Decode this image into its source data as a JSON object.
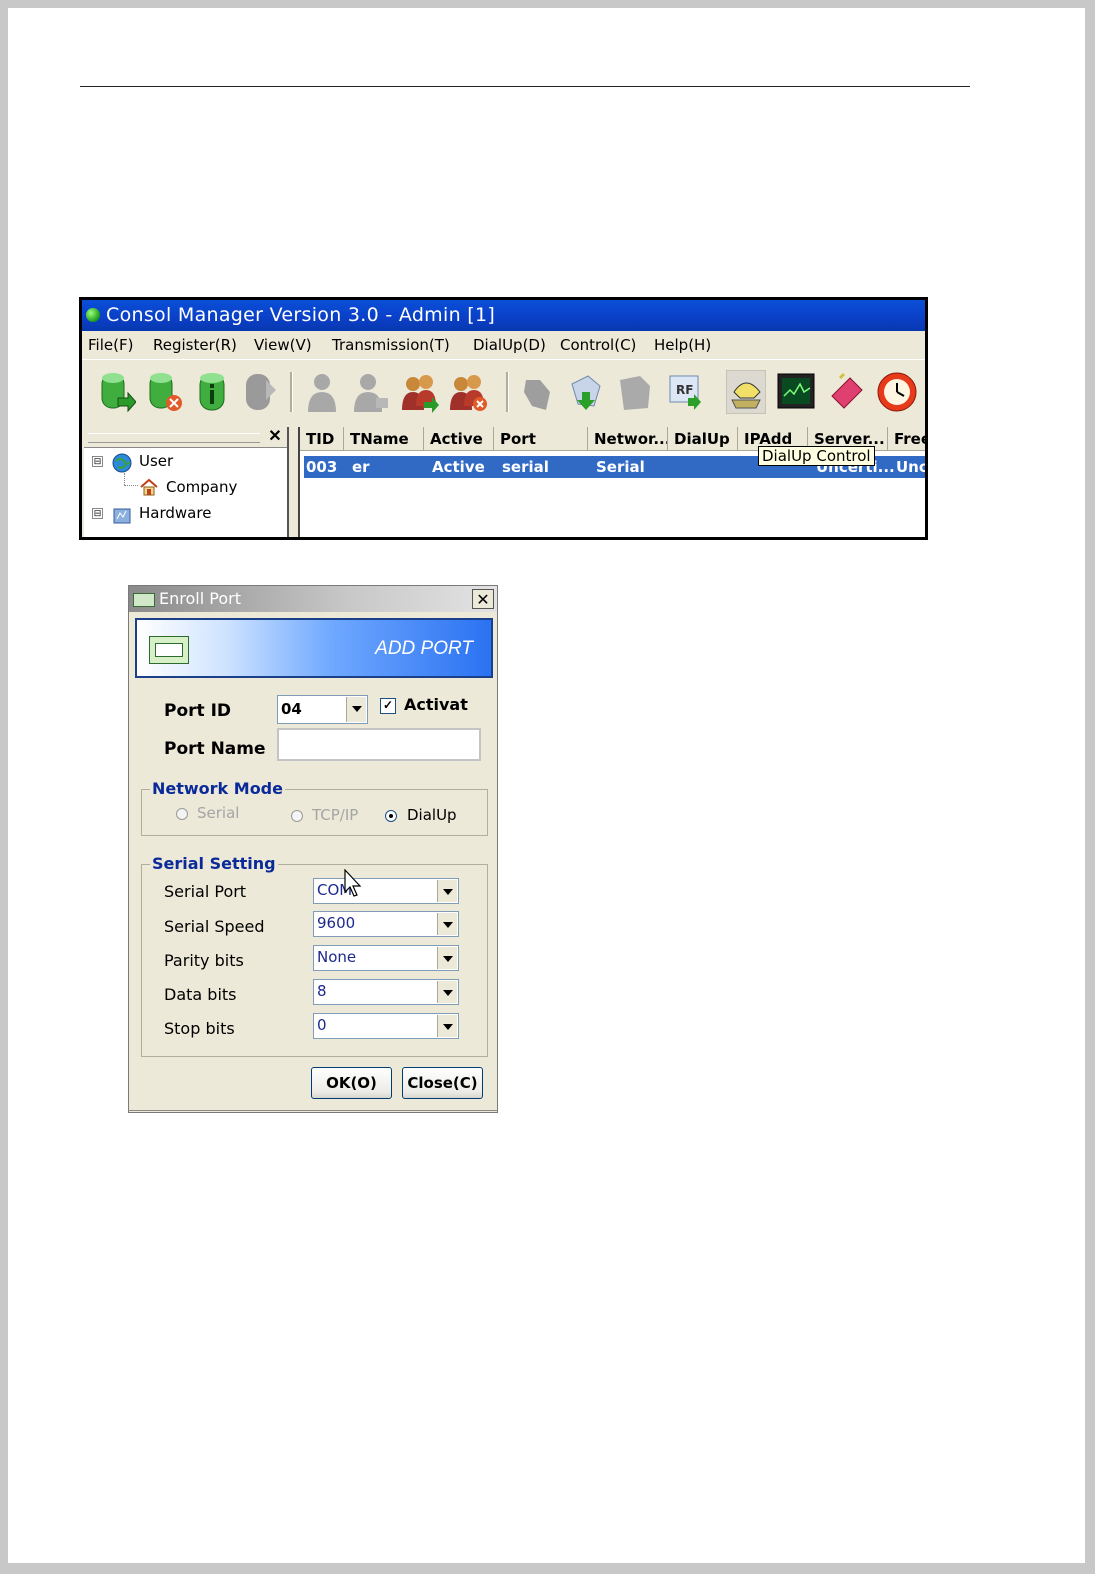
{
  "app": {
    "title": "Consol Manager Version 3.0 - Admin [1]",
    "menu": [
      "File(F)",
      "Register(R)",
      "View(V)",
      "Transmission(T)",
      "DialUp(D)",
      "Control(C)",
      "Help(H)"
    ],
    "toolbar_icons": [
      "user-add-icon",
      "user-delete-icon",
      "user-info-icon",
      "user-disabled-icon",
      "person-icon",
      "person-edit-icon",
      "group-add-icon",
      "group-delete-icon",
      "hand-icon",
      "download-icon",
      "transfer-icon",
      "rf-download-icon",
      "telephone-icon",
      "monitor-icon",
      "eraser-icon",
      "clock-icon"
    ],
    "tree": {
      "close": "✕",
      "nodes": [
        {
          "label": "User",
          "expander": "⊟"
        },
        {
          "label": "Company"
        },
        {
          "label": "Hardware",
          "expander": "⊟"
        }
      ]
    },
    "grid": {
      "columns": [
        "TID",
        "TName",
        "Active",
        "Port",
        "Networ...",
        "DialUp",
        "IPAdd",
        "Server...",
        "Free"
      ],
      "rows": [
        {
          "tid": "003",
          "tname": "er",
          "active": "Active",
          "port": "serial",
          "network": "Serial",
          "server": "Uncerti...",
          "free": "Unc"
        }
      ]
    },
    "tooltip": "DialUp Control"
  },
  "dialog": {
    "title": "Enroll Port",
    "close": "✕",
    "banner": "ADD PORT",
    "port_id_label": "Port ID",
    "port_id_value": "04",
    "activate_label": "Activat",
    "activate_checked": "✓",
    "port_name_label": "Port Name",
    "port_name_value": "",
    "network_mode": {
      "title": "Network Mode",
      "options": [
        {
          "label": "Serial",
          "selected": false,
          "enabled": false
        },
        {
          "label": "TCP/IP",
          "selected": false,
          "enabled": false
        },
        {
          "label": "DialUp",
          "selected": true,
          "enabled": true
        }
      ]
    },
    "serial_setting": {
      "title": "Serial Setting",
      "fields": [
        {
          "label": "Serial Port",
          "value": "COM"
        },
        {
          "label": "Serial Speed",
          "value": "9600"
        },
        {
          "label": "Parity bits",
          "value": "None"
        },
        {
          "label": "Data bits",
          "value": "8"
        },
        {
          "label": "Stop bits",
          "value": "0"
        }
      ]
    },
    "ok_label": "OK(O)",
    "close_label": "Close(C)"
  }
}
